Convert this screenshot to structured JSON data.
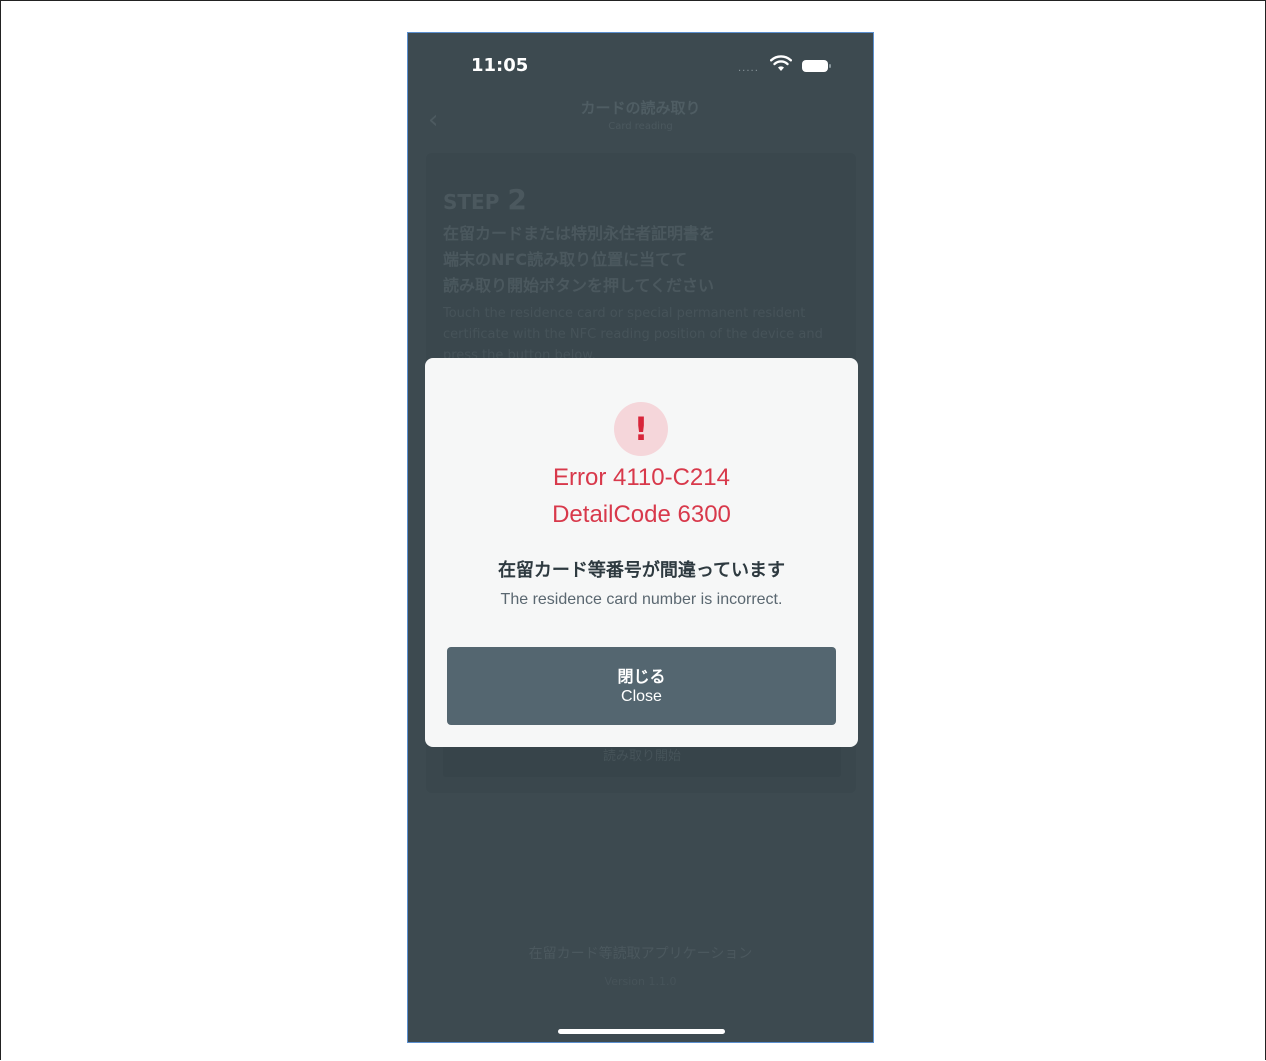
{
  "status_bar": {
    "time": "11:05",
    "signal_dots": ".....",
    "wifi_icon": "wifi-icon",
    "battery_icon": "battery-icon"
  },
  "background_screen": {
    "back_icon": "chevron-left-icon",
    "title": "カードの読み取り",
    "subtitle": "Card reading",
    "step_label": "STEP",
    "step_number": "2",
    "instruction_jp": "在留カードまたは特別永住者証明書を\n端末のNFC読み取り位置に当てて\n読み取り開始ボタンを押してください",
    "instruction_en": "Touch the residence card or special permanent resident certificate with the NFC reading position of the device and press the button below.",
    "start_button_label": "読み取り開始",
    "app_name": "在留カード等読取アプリケーション",
    "app_version": "Version 1.1.0"
  },
  "dialog": {
    "icon": "exclamation-icon",
    "icon_glyph": "!",
    "error_code": "Error 4110-C214",
    "detail_code": "DetailCode 6300",
    "message_jp": "在留カード等番号が間違っています",
    "message_en": "The residence card number is incorrect.",
    "close_label_jp": "閉じる",
    "close_label_en": "Close"
  },
  "colors": {
    "overlay_background": "#3d4a50",
    "dialog_background": "#f6f7f7",
    "error_red": "#d8394b",
    "error_badge_bg": "#f5d6da",
    "button_background": "#546670"
  }
}
